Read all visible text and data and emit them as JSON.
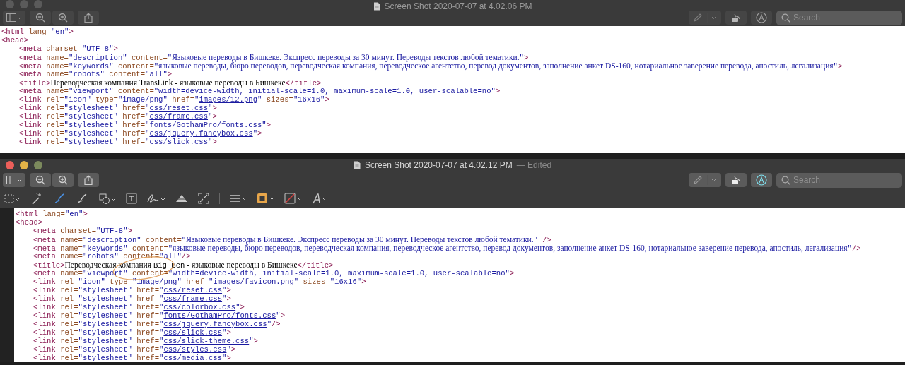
{
  "windows": [
    {
      "title": "Screen Shot 2020-07-07 at 4.02.06 PM",
      "active": false,
      "markup_active": false,
      "gutter": false,
      "search": {
        "placeholder": "Search"
      },
      "code": [
        {
          "tokens": [
            {
              "kind": "tag",
              "text": "<html"
            },
            {
              "kind": "attr",
              "text": " lang="
            },
            {
              "kind": "str",
              "text": "\"en\""
            },
            {
              "kind": "tag",
              "text": ">"
            }
          ]
        },
        {
          "tokens": [
            {
              "kind": "tag",
              "text": "<head>"
            }
          ],
          "children": [
            {
              "tokens": [
                {
                  "kind": "tag",
                  "text": "<meta"
                },
                {
                  "kind": "attr",
                  "text": " charset="
                },
                {
                  "kind": "str",
                  "text": "\"UTF-8\""
                },
                {
                  "kind": "tag",
                  "text": ">"
                }
              ]
            },
            {
              "tokens": [
                {
                  "kind": "tag",
                  "text": "<meta"
                },
                {
                  "kind": "attr",
                  "text": " name="
                },
                {
                  "kind": "str",
                  "text": "\"description\""
                },
                {
                  "kind": "attr",
                  "text": " content="
                },
                {
                  "kind": "str",
                  "text": "\""
                },
                {
                  "kind": "prose",
                  "text": "Языковые переводы в Бишкеке. Экспресс переводы за 30 минут. Переводы текстов любой тематики."
                },
                {
                  "kind": "str",
                  "text": "\""
                },
                {
                  "kind": "tag",
                  "text": ">"
                }
              ]
            },
            {
              "tokens": [
                {
                  "kind": "tag",
                  "text": "<meta"
                },
                {
                  "kind": "attr",
                  "text": " name="
                },
                {
                  "kind": "str",
                  "text": "\"keywords\""
                },
                {
                  "kind": "attr",
                  "text": " content="
                },
                {
                  "kind": "str",
                  "text": "\""
                },
                {
                  "kind": "prose",
                  "text": "языковые переводы, бюро переводов, переводческая компания, переводческое агентство, перевод документов, заполнение анкет DS-160, нотариальное заверение перевода, апостиль, легализация"
                },
                {
                  "kind": "str",
                  "text": "\""
                },
                {
                  "kind": "tag",
                  "text": ">"
                }
              ]
            },
            {
              "tokens": [
                {
                  "kind": "tag",
                  "text": "<meta"
                },
                {
                  "kind": "attr",
                  "text": " name="
                },
                {
                  "kind": "str",
                  "text": "\"robots\""
                },
                {
                  "kind": "attr",
                  "text": " content="
                },
                {
                  "kind": "str",
                  "text": "\"all\""
                },
                {
                  "kind": "tag",
                  "text": ">"
                }
              ]
            },
            {
              "tokens": [
                {
                  "kind": "tag",
                  "text": "<title>"
                },
                {
                  "kind": "text",
                  "text": "Переводческая компания TransLink - языковые переводы в Бишкеке"
                },
                {
                  "kind": "tag",
                  "text": "</title>"
                }
              ]
            },
            {
              "tokens": [
                {
                  "kind": "tag",
                  "text": "<meta"
                },
                {
                  "kind": "attr",
                  "text": " name="
                },
                {
                  "kind": "str",
                  "text": "\"viewport\""
                },
                {
                  "kind": "attr",
                  "text": " content="
                },
                {
                  "kind": "str",
                  "text": "\"width=device-width, initial-scale=1.0, maximum-scale=1.0, user-scalable=no\""
                },
                {
                  "kind": "tag",
                  "text": ">"
                }
              ]
            },
            {
              "tokens": [
                {
                  "kind": "tag",
                  "text": "<link"
                },
                {
                  "kind": "attr",
                  "text": " rel="
                },
                {
                  "kind": "str",
                  "text": "\"icon\""
                },
                {
                  "kind": "attr",
                  "text": " type="
                },
                {
                  "kind": "str",
                  "text": "\"image/png\""
                },
                {
                  "kind": "attr",
                  "text": " href="
                },
                {
                  "kind": "str",
                  "text": "\""
                },
                {
                  "kind": "link",
                  "text": "images/12.png"
                },
                {
                  "kind": "str",
                  "text": "\""
                },
                {
                  "kind": "attr",
                  "text": " sizes="
                },
                {
                  "kind": "str",
                  "text": "\"16x16\""
                },
                {
                  "kind": "tag",
                  "text": ">"
                }
              ]
            },
            {
              "tokens": [
                {
                  "kind": "tag",
                  "text": "<link"
                },
                {
                  "kind": "attr",
                  "text": " rel="
                },
                {
                  "kind": "str",
                  "text": "\"stylesheet\""
                },
                {
                  "kind": "attr",
                  "text": " href="
                },
                {
                  "kind": "str",
                  "text": "\""
                },
                {
                  "kind": "link",
                  "text": "css/reset.css"
                },
                {
                  "kind": "str",
                  "text": "\""
                },
                {
                  "kind": "tag",
                  "text": ">"
                }
              ]
            },
            {
              "tokens": [
                {
                  "kind": "tag",
                  "text": "<link"
                },
                {
                  "kind": "attr",
                  "text": " rel="
                },
                {
                  "kind": "str",
                  "text": "\"stylesheet\""
                },
                {
                  "kind": "attr",
                  "text": " href="
                },
                {
                  "kind": "str",
                  "text": "\""
                },
                {
                  "kind": "link",
                  "text": "css/frame.css"
                },
                {
                  "kind": "str",
                  "text": "\""
                },
                {
                  "kind": "tag",
                  "text": ">"
                }
              ]
            },
            {
              "tokens": [
                {
                  "kind": "tag",
                  "text": "<link"
                },
                {
                  "kind": "attr",
                  "text": " rel="
                },
                {
                  "kind": "str",
                  "text": "\"stylesheet\""
                },
                {
                  "kind": "attr",
                  "text": " href="
                },
                {
                  "kind": "str",
                  "text": "\""
                },
                {
                  "kind": "link",
                  "text": "fonts/GothamPro/fonts.css"
                },
                {
                  "kind": "str",
                  "text": "\""
                },
                {
                  "kind": "tag",
                  "text": ">"
                }
              ]
            },
            {
              "tokens": [
                {
                  "kind": "tag",
                  "text": "<link"
                },
                {
                  "kind": "attr",
                  "text": " rel="
                },
                {
                  "kind": "str",
                  "text": "\"stylesheet\""
                },
                {
                  "kind": "attr",
                  "text": " href="
                },
                {
                  "kind": "str",
                  "text": "\""
                },
                {
                  "kind": "link",
                  "text": "css/jquery.fancybox.css"
                },
                {
                  "kind": "str",
                  "text": "\""
                },
                {
                  "kind": "tag",
                  "text": ">"
                }
              ]
            },
            {
              "tokens": [
                {
                  "kind": "tag",
                  "text": "<link"
                },
                {
                  "kind": "attr",
                  "text": " rel="
                },
                {
                  "kind": "str",
                  "text": "\"stylesheet\""
                },
                {
                  "kind": "attr",
                  "text": " href="
                },
                {
                  "kind": "str",
                  "text": "\""
                },
                {
                  "kind": "link",
                  "text": "css/slick.css"
                },
                {
                  "kind": "str",
                  "text": "\""
                },
                {
                  "kind": "tag",
                  "text": ">"
                }
              ]
            }
          ]
        }
      ]
    },
    {
      "title": "Screen Shot 2020-07-07 at 4.02.12 PM",
      "title_suffix": "— Edited",
      "active": true,
      "markup_active": true,
      "gutter": true,
      "search": {
        "placeholder": "Search"
      },
      "code": [
        {
          "tokens": [
            {
              "kind": "tag",
              "text": "<html"
            },
            {
              "kind": "attr",
              "text": " lang="
            },
            {
              "kind": "str",
              "text": "\"en\""
            },
            {
              "kind": "tag",
              "text": ">"
            }
          ]
        },
        {
          "tokens": [
            {
              "kind": "tag",
              "text": "<head>"
            }
          ],
          "children": [
            {
              "tokens": [
                {
                  "kind": "tag",
                  "text": "<meta"
                },
                {
                  "kind": "attr",
                  "text": " charset="
                },
                {
                  "kind": "str",
                  "text": "\"UTF-8\""
                },
                {
                  "kind": "tag",
                  "text": ">"
                }
              ]
            },
            {
              "tokens": [
                {
                  "kind": "tag",
                  "text": "<meta"
                },
                {
                  "kind": "attr",
                  "text": " name="
                },
                {
                  "kind": "str",
                  "text": "\"description\""
                },
                {
                  "kind": "attr",
                  "text": " content="
                },
                {
                  "kind": "str",
                  "text": "\""
                },
                {
                  "kind": "prose",
                  "text": "Языковые переводы в Бишкеке. Экспресс переводы за 30 минут. Переводы текстов любой тематики."
                },
                {
                  "kind": "str",
                  "text": "\""
                },
                {
                  "kind": "tag",
                  "text": " />"
                }
              ]
            },
            {
              "tokens": [
                {
                  "kind": "tag",
                  "text": "<meta"
                },
                {
                  "kind": "attr",
                  "text": " name="
                },
                {
                  "kind": "str",
                  "text": "\"keywords\""
                },
                {
                  "kind": "attr",
                  "text": " content="
                },
                {
                  "kind": "str",
                  "text": "\""
                },
                {
                  "kind": "prose",
                  "text": "языковые переводы, бюро переводов, переводческая компания, переводческое агентство, перевод документов, заполнение анкет DS-160, нотариальное заверение перевода, апостиль, легализация"
                },
                {
                  "kind": "str",
                  "text": "\""
                },
                {
                  "kind": "tag",
                  "text": "/>"
                }
              ]
            },
            {
              "tokens": [
                {
                  "kind": "tag",
                  "text": "<meta"
                },
                {
                  "kind": "attr",
                  "text": " name="
                },
                {
                  "kind": "str",
                  "text": "\"robots\""
                },
                {
                  "kind": "attr",
                  "text": " content="
                },
                {
                  "kind": "str",
                  "text": "\"all\""
                },
                {
                  "kind": "tag",
                  "text": "/>"
                }
              ]
            },
            {
              "tokens": [
                {
                  "kind": "tag",
                  "text": "<title>"
                },
                {
                  "kind": "text",
                  "text": "Переводческая компания "
                },
                {
                  "kind": "plain",
                  "text": "Big Ben"
                },
                {
                  "kind": "text",
                  "text": " - языковые переводы в Бишкеке"
                },
                {
                  "kind": "tag",
                  "text": "</title>"
                }
              ],
              "circled": true
            },
            {
              "tokens": [
                {
                  "kind": "tag",
                  "text": "<meta"
                },
                {
                  "kind": "attr",
                  "text": " name="
                },
                {
                  "kind": "str",
                  "text": "\"viewport\""
                },
                {
                  "kind": "attr",
                  "text": " content="
                },
                {
                  "kind": "str",
                  "text": "\"width=device-width, initial-scale=1.0, maximum-scale=1.0, user-scalable=no\""
                },
                {
                  "kind": "tag",
                  "text": ">"
                }
              ]
            },
            {
              "tokens": [
                {
                  "kind": "tag",
                  "text": "<link"
                },
                {
                  "kind": "attr",
                  "text": " rel="
                },
                {
                  "kind": "str",
                  "text": "\"icon\""
                },
                {
                  "kind": "attr",
                  "text": " type="
                },
                {
                  "kind": "str",
                  "text": "\"image/png\""
                },
                {
                  "kind": "attr",
                  "text": " href="
                },
                {
                  "kind": "str",
                  "text": "\""
                },
                {
                  "kind": "link",
                  "text": "images/favicon.png"
                },
                {
                  "kind": "str",
                  "text": "\""
                },
                {
                  "kind": "attr",
                  "text": " sizes="
                },
                {
                  "kind": "str",
                  "text": "\"16x16\""
                },
                {
                  "kind": "tag",
                  "text": ">"
                }
              ]
            },
            {
              "tokens": [
                {
                  "kind": "tag",
                  "text": "<link"
                },
                {
                  "kind": "attr",
                  "text": " rel="
                },
                {
                  "kind": "str",
                  "text": "\"stylesheet\""
                },
                {
                  "kind": "attr",
                  "text": " href="
                },
                {
                  "kind": "str",
                  "text": "\""
                },
                {
                  "kind": "link",
                  "text": "css/reset.css"
                },
                {
                  "kind": "str",
                  "text": "\""
                },
                {
                  "kind": "tag",
                  "text": ">"
                }
              ]
            },
            {
              "tokens": [
                {
                  "kind": "tag",
                  "text": "<link"
                },
                {
                  "kind": "attr",
                  "text": " rel="
                },
                {
                  "kind": "str",
                  "text": "\"stylesheet\""
                },
                {
                  "kind": "attr",
                  "text": " href="
                },
                {
                  "kind": "str",
                  "text": "\""
                },
                {
                  "kind": "link",
                  "text": "css/frame.css"
                },
                {
                  "kind": "str",
                  "text": "\""
                },
                {
                  "kind": "tag",
                  "text": ">"
                }
              ]
            },
            {
              "tokens": [
                {
                  "kind": "tag",
                  "text": "<link"
                },
                {
                  "kind": "attr",
                  "text": " rel="
                },
                {
                  "kind": "str",
                  "text": "\"stylesheet\""
                },
                {
                  "kind": "attr",
                  "text": " href="
                },
                {
                  "kind": "str",
                  "text": "\""
                },
                {
                  "kind": "link",
                  "text": "css/colorbox.css"
                },
                {
                  "kind": "str",
                  "text": "\""
                },
                {
                  "kind": "tag",
                  "text": ">"
                }
              ]
            },
            {
              "tokens": [
                {
                  "kind": "tag",
                  "text": "<link"
                },
                {
                  "kind": "attr",
                  "text": " rel="
                },
                {
                  "kind": "str",
                  "text": "\"stylesheet\""
                },
                {
                  "kind": "attr",
                  "text": " href="
                },
                {
                  "kind": "str",
                  "text": "\""
                },
                {
                  "kind": "link",
                  "text": "fonts/GothamPro/fonts.css"
                },
                {
                  "kind": "str",
                  "text": "\""
                },
                {
                  "kind": "tag",
                  "text": ">"
                }
              ]
            },
            {
              "tokens": [
                {
                  "kind": "tag",
                  "text": "<link"
                },
                {
                  "kind": "attr",
                  "text": " rel="
                },
                {
                  "kind": "str",
                  "text": "\"stylesheet\""
                },
                {
                  "kind": "attr",
                  "text": " href="
                },
                {
                  "kind": "str",
                  "text": "\""
                },
                {
                  "kind": "link",
                  "text": "css/jquery.fancybox.css"
                },
                {
                  "kind": "str",
                  "text": "\""
                },
                {
                  "kind": "tag",
                  "text": "/>"
                }
              ]
            },
            {
              "tokens": [
                {
                  "kind": "tag",
                  "text": "<link"
                },
                {
                  "kind": "attr",
                  "text": " rel="
                },
                {
                  "kind": "str",
                  "text": "\"stylesheet\""
                },
                {
                  "kind": "attr",
                  "text": " href="
                },
                {
                  "kind": "str",
                  "text": "\""
                },
                {
                  "kind": "link",
                  "text": "css/slick.css"
                },
                {
                  "kind": "str",
                  "text": "\""
                },
                {
                  "kind": "tag",
                  "text": ">"
                }
              ]
            },
            {
              "tokens": [
                {
                  "kind": "tag",
                  "text": "<link"
                },
                {
                  "kind": "attr",
                  "text": " rel="
                },
                {
                  "kind": "str",
                  "text": "\"stylesheet\""
                },
                {
                  "kind": "attr",
                  "text": " href="
                },
                {
                  "kind": "str",
                  "text": "\""
                },
                {
                  "kind": "link",
                  "text": "css/slick-theme.css"
                },
                {
                  "kind": "str",
                  "text": "\""
                },
                {
                  "kind": "tag",
                  "text": ">"
                }
              ]
            },
            {
              "tokens": [
                {
                  "kind": "tag",
                  "text": "<link"
                },
                {
                  "kind": "attr",
                  "text": " rel="
                },
                {
                  "kind": "str",
                  "text": "\"stylesheet\""
                },
                {
                  "kind": "attr",
                  "text": " href="
                },
                {
                  "kind": "str",
                  "text": "\""
                },
                {
                  "kind": "link",
                  "text": "css/styles.css"
                },
                {
                  "kind": "str",
                  "text": "\""
                },
                {
                  "kind": "tag",
                  "text": ">"
                }
              ]
            },
            {
              "tokens": [
                {
                  "kind": "tag",
                  "text": "<link"
                },
                {
                  "kind": "attr",
                  "text": " rel="
                },
                {
                  "kind": "str",
                  "text": "\"stylesheet\""
                },
                {
                  "kind": "attr",
                  "text": " href="
                },
                {
                  "kind": "str",
                  "text": "\""
                },
                {
                  "kind": "link",
                  "text": "css/media.css"
                },
                {
                  "kind": "str",
                  "text": "\""
                },
                {
                  "kind": "tag",
                  "text": ">"
                }
              ]
            }
          ]
        }
      ]
    }
  ]
}
